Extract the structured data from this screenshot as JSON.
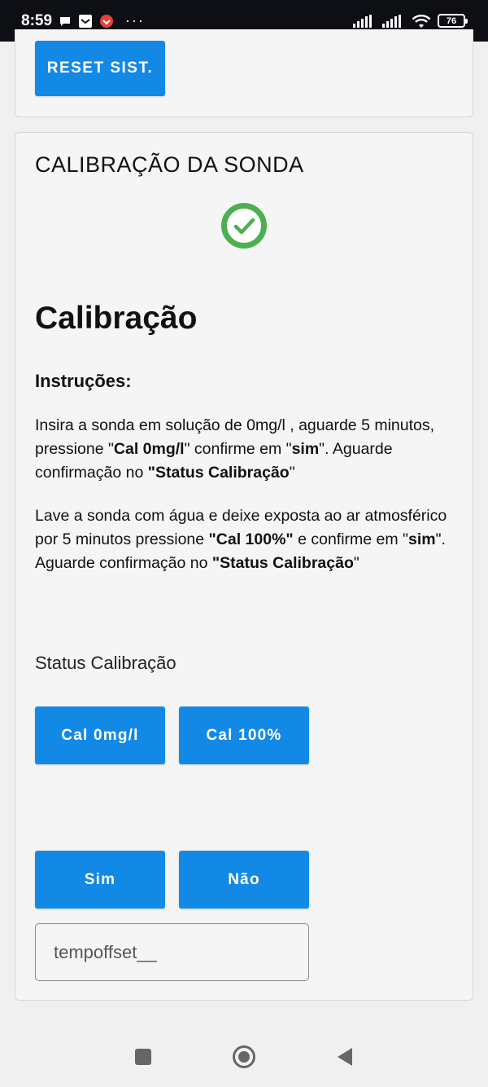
{
  "status_bar": {
    "time": "8:59",
    "dots": "···",
    "battery": "76"
  },
  "top_card": {
    "reset_label": "RESET SIST."
  },
  "calibration_card": {
    "title": "CALIBRAÇÃO DA SONDA",
    "heading": "Calibração",
    "subheading": "Instruções:",
    "para1": {
      "t1": "Insira a sonda em solução de 0mg/l , aguarde 5 minutos, pressione \"",
      "b1": "Cal 0mg/l",
      "t2": "\" confirme em \"",
      "b2": "sim",
      "t3": "\". Aguarde confirmação no ",
      "b3": "\"Status Calibração",
      "t4": "\""
    },
    "para2": {
      "t1": "Lave a sonda com água e deixe exposta ao ar atmosférico por 5 minutos pressione ",
      "b1": "\"Cal 100%\"",
      "t2": " e confirme em \"",
      "b2": "sim",
      "t3": "\". Aguarde confirmação no ",
      "b3": "\"Status Calibração",
      "t4": "\""
    },
    "status_label": "Status Calibração",
    "buttons": {
      "cal0": "Cal 0mg/l",
      "cal100": "Cal 100%",
      "sim": "Sim",
      "nao": "Não"
    },
    "input": {
      "placeholder": "tempoffset__",
      "value": ""
    }
  },
  "colors": {
    "primary": "#1389e6",
    "success": "#4caf50",
    "status_bar_bg": "#0d0f14"
  },
  "icons": [
    "chat-bubble-icon",
    "inbox-icon",
    "app-badge-icon",
    "signal-icon",
    "wifi-icon",
    "battery-icon",
    "check-circle-icon",
    "nav-recent-icon",
    "nav-home-icon",
    "nav-back-icon"
  ]
}
